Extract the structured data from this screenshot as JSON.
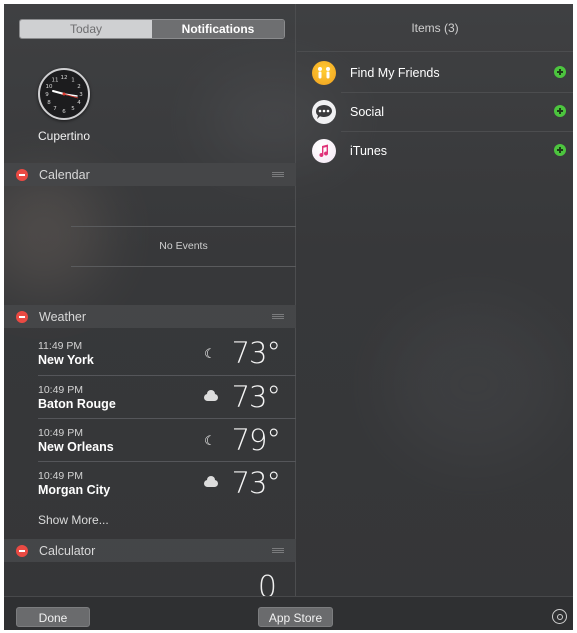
{
  "tabs": {
    "today": "Today",
    "notifications": "Notifications"
  },
  "clock": {
    "city": "Cupertino"
  },
  "calendar": {
    "title": "Calendar",
    "empty_text": "No Events"
  },
  "weather": {
    "title": "Weather",
    "rows": [
      {
        "time": "11:49 PM",
        "city": "New York",
        "icon": "moon-icon",
        "temp": "73°"
      },
      {
        "time": "10:49 PM",
        "city": "Baton Rouge",
        "icon": "cloud-icon",
        "temp": "73°"
      },
      {
        "time": "10:49 PM",
        "city": "New Orleans",
        "icon": "moon-icon",
        "temp": "79°"
      },
      {
        "time": "10:49 PM",
        "city": "Morgan City",
        "icon": "cloud-icon",
        "temp": "73°"
      }
    ],
    "show_more": "Show More..."
  },
  "calculator": {
    "title": "Calculator",
    "value": "0"
  },
  "items": {
    "title": "Items (3)",
    "list": [
      {
        "label": "Find My Friends",
        "icon": "find-my-friends-icon"
      },
      {
        "label": "Social",
        "icon": "social-icon"
      },
      {
        "label": "iTunes",
        "icon": "itunes-icon"
      }
    ]
  },
  "bottom": {
    "done": "Done",
    "app_store": "App Store"
  },
  "colors": {
    "remove": "#ea4a43",
    "add": "#4cc53e",
    "panel": "#3a3b3d"
  }
}
